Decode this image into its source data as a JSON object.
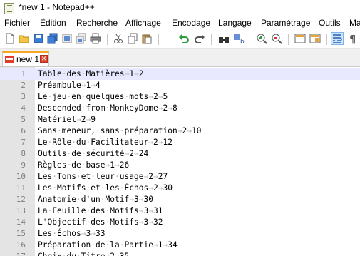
{
  "window": {
    "title": "*new 1 - Notepad++"
  },
  "menu": [
    "Fichier",
    "Édition",
    "Recherche",
    "Affichage",
    "Encodage",
    "Langage",
    "Paramétrage",
    "Outils",
    "Ma"
  ],
  "toolbar": {
    "icons": [
      "new-file-icon",
      "open-file-icon",
      "save-icon",
      "save-all-icon",
      "close-icon",
      "close-all-icon",
      "print-icon",
      "cut-icon",
      "copy-icon",
      "paste-icon",
      "undo-icon",
      "redo-icon",
      "find-icon",
      "replace-icon",
      "zoom-in-icon",
      "zoom-out-icon",
      "sync-vertical-icon",
      "sync-horizontal-icon",
      "word-wrap-icon",
      "show-all-characters-icon"
    ]
  },
  "tab": {
    "label": "new 1",
    "close_glyph": "✕"
  },
  "editor": {
    "current_line": 1,
    "line_numbers": [
      "1",
      "2",
      "3",
      "4",
      "5",
      "6",
      "7",
      "8",
      "9",
      "10",
      "11",
      "12",
      "13",
      "14",
      "15",
      "16",
      "17"
    ],
    "lines": [
      "Table·des·Matières→1→2",
      "Préambule→1→4",
      "Le·jeu·en·quelques·mots→2→5",
      "Descended·from·MonkeyDome→2→8",
      "Matériel→2→9",
      "Sans·meneur,·sans·préparation→2→10",
      "Le·Rôle·du·Facilitateur→2→12",
      "Outils·de·sécurité→2→24",
      "Règles·de·base→1→26",
      "Les·Tons·et·leur·usage→2→27",
      "Les·Motifs·et·les·Échos→2→30",
      "Anatomie·d'un·Motif→3→30",
      "La·Feuille·des·Motifs→3→31",
      "L'Objectif·des·Motifs→3→32",
      "Les·Échos→3→33",
      "Préparation·de·la·Partie→1→34",
      "Choix·du·Titre→2→35"
    ]
  }
}
